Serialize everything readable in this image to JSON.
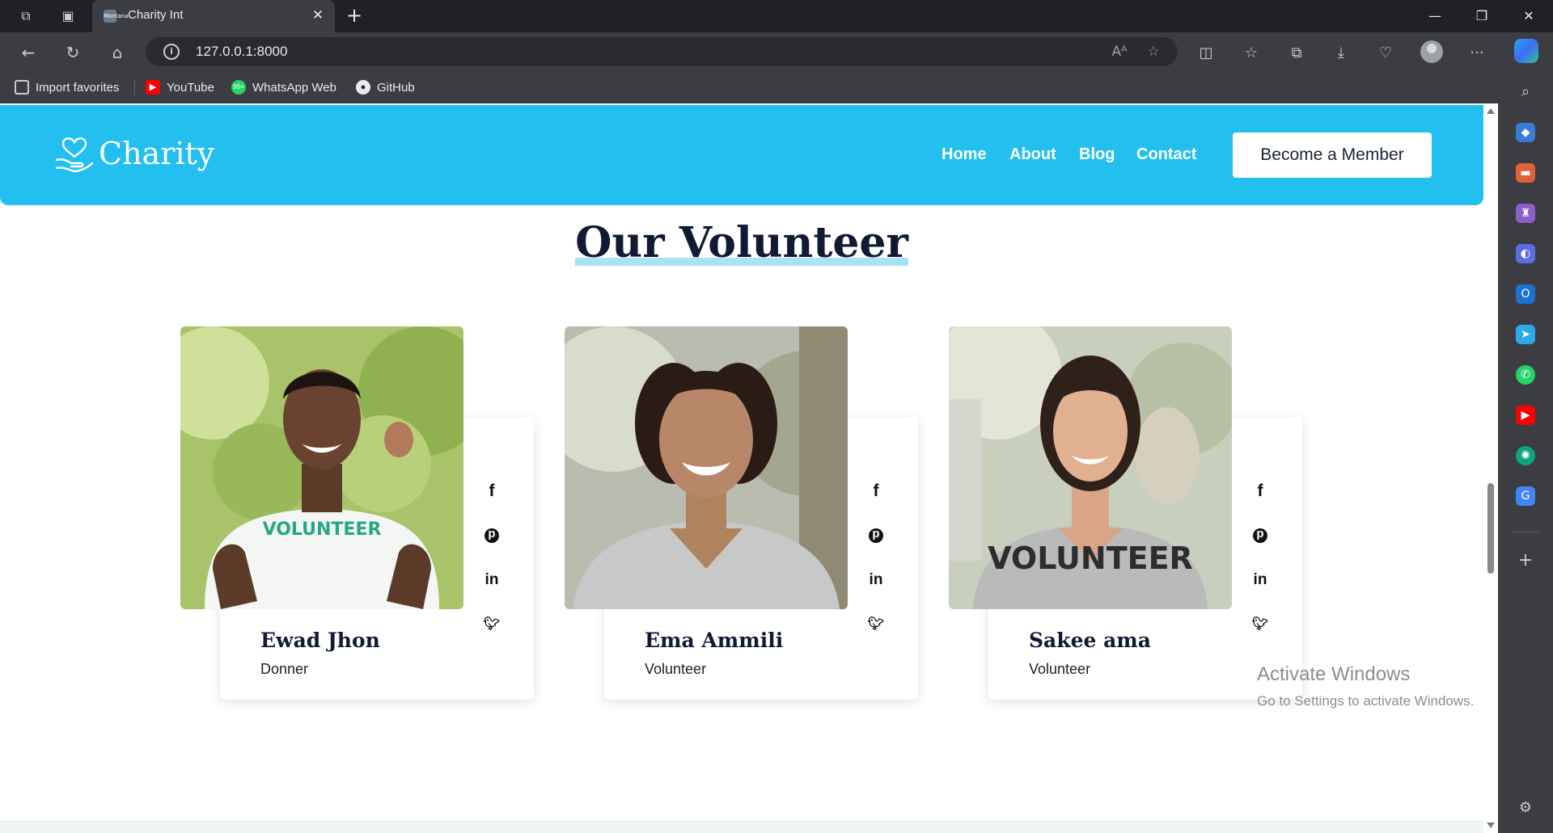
{
  "browser": {
    "tab_title": "Charity Int",
    "tab_favicon_text": "Montana",
    "url": "127.0.0.1:8000",
    "favorites": [
      "Import favorites",
      "YouTube",
      "WhatsApp Web",
      "GitHub"
    ],
    "whatsapp_badge": "99+"
  },
  "site": {
    "logo_text": "Charity",
    "nav": [
      "Home",
      "About",
      "Blog",
      "Contact"
    ],
    "cta_label": "Become a Member",
    "brand_color": "#23c0ef"
  },
  "section": {
    "title": "Our Volunteer"
  },
  "volunteers": [
    {
      "name": "Ewad Jhon",
      "role": "Donner",
      "shirt_text": "VOLUNTEER"
    },
    {
      "name": "Ema Ammili",
      "role": "Volunteer"
    },
    {
      "name": "Sakee ama",
      "role": "Volunteer",
      "shirt_text": "VOLUNTEER"
    }
  ],
  "social_icons": [
    "facebook-icon",
    "pinterest-icon",
    "linkedin-icon",
    "twitter-icon"
  ],
  "watermark": {
    "line1": "Activate Windows",
    "line2": "Go to Settings to activate Windows."
  }
}
